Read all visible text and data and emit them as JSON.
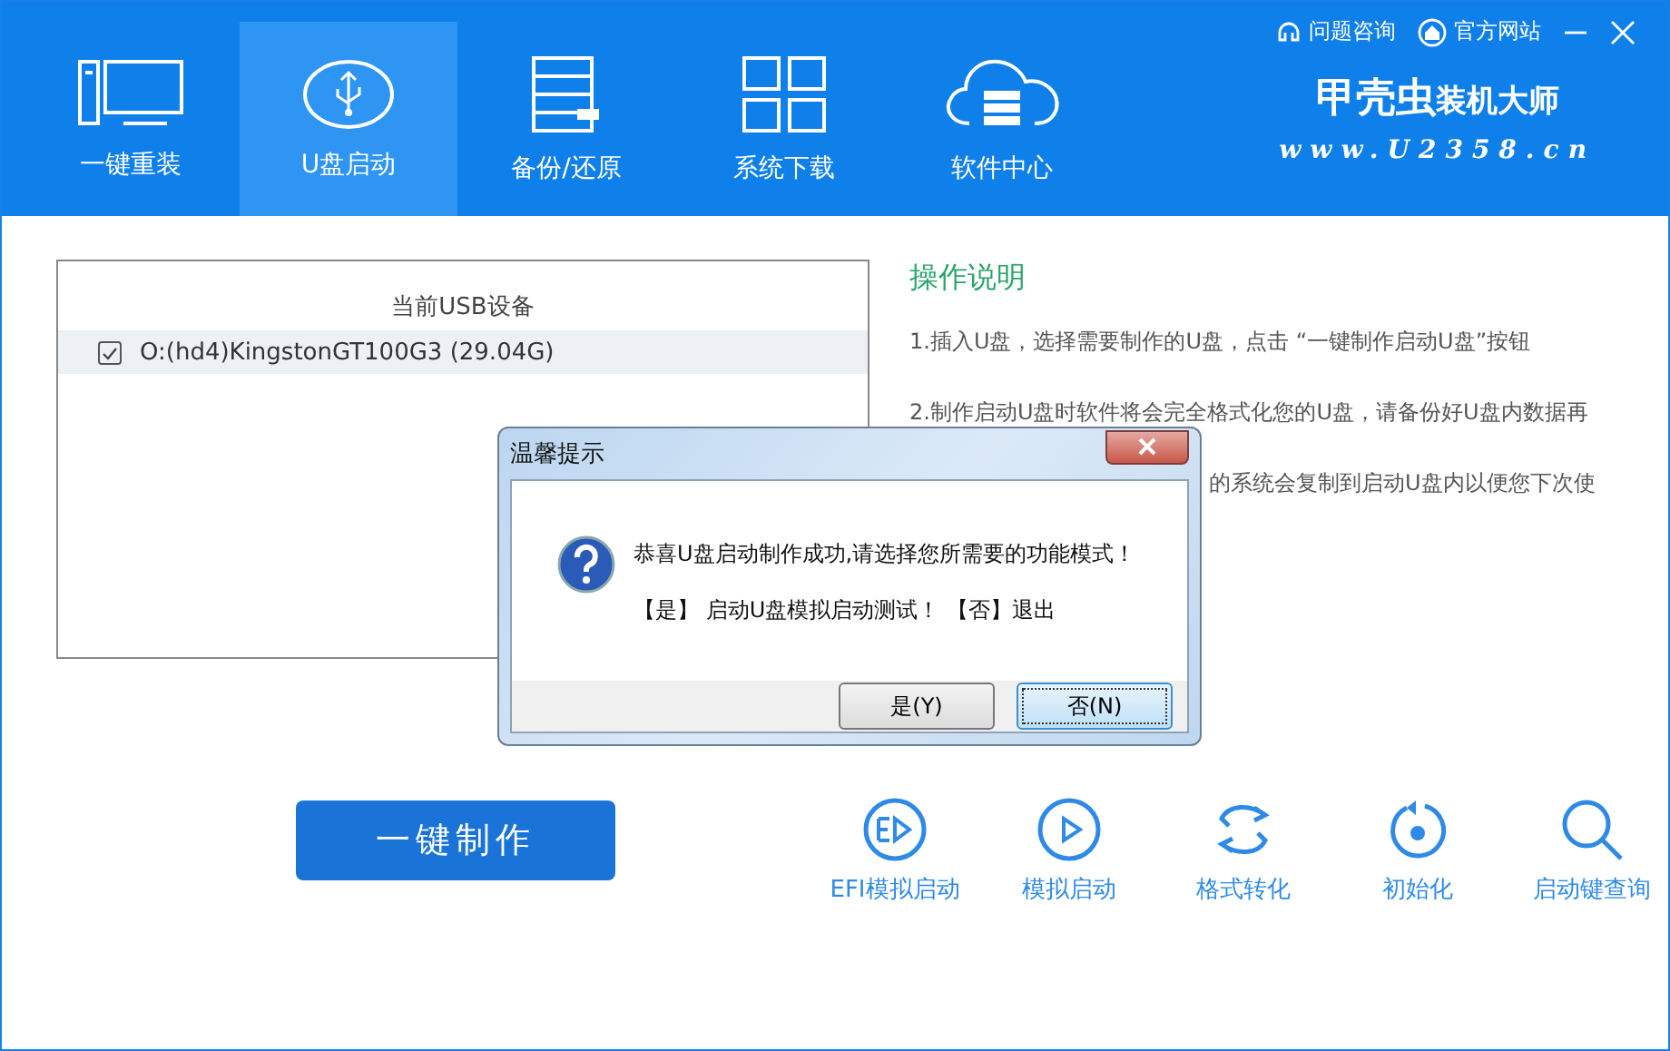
{
  "header": {
    "tabs": [
      {
        "label": "一键重装",
        "selected": false
      },
      {
        "label": "U盘启动",
        "selected": true
      },
      {
        "label": "备份/还原",
        "selected": false
      },
      {
        "label": "系统下载",
        "selected": false
      },
      {
        "label": "软件中心",
        "selected": false
      }
    ],
    "links": [
      "问题咨询",
      "官方网站"
    ],
    "logo": {
      "title": "甲壳虫",
      "subtitle": "装机大师",
      "url": "www.U2358.cn"
    }
  },
  "devices": {
    "heading": "当前USB设备",
    "items": [
      {
        "label": "O:(hd4)KingstonGT100G3 (29.04G)",
        "checked": true
      }
    ]
  },
  "make_button": "一键制作",
  "instructions": {
    "title": "操作说明",
    "lines": [
      {
        "text": "1.插入U盘，选择需要制作的U盘，点击 “一键制作启动U盘”按钮",
        "kind": "full"
      },
      {
        "text": "2.制作启动U盘时软件将会完全格式化您的U盘，请备份好U盘内数据再",
        "kind": "full"
      },
      {
        "text": "的系统会复制到启动U盘内以便您下次使",
        "kind": "partial"
      }
    ]
  },
  "tools": [
    "EFI模拟启动",
    "模拟启动",
    "格式转化",
    "初始化",
    "启动键查询"
  ],
  "dialog": {
    "title": "温馨提示",
    "message": "恭喜U盘启动制作成功,请选择您所需要的功能模式！",
    "detail": "【是】 启动U盘模拟启动测试！ 【否】退出",
    "buttons": [
      {
        "label": "是(Y)",
        "selected": false
      },
      {
        "label": "否(N)",
        "selected": true
      }
    ]
  }
}
